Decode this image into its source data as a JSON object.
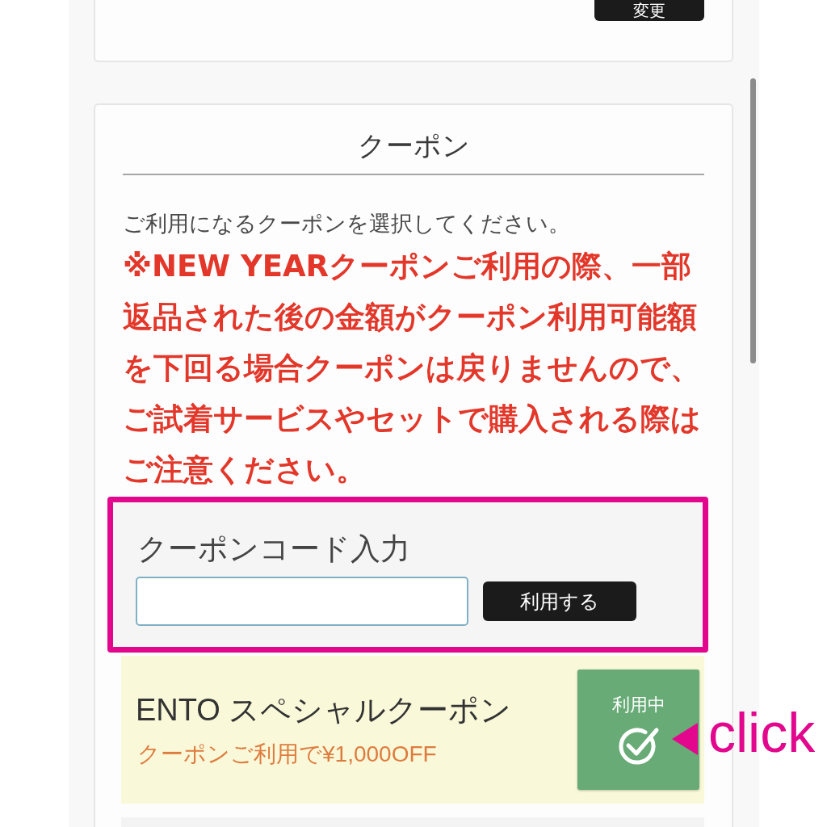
{
  "top_card": {
    "button": "変更"
  },
  "coupon_section": {
    "title": "クーポン",
    "instruction": "ご利用になるクーポンを選択してください。",
    "warning": "※NEW YEARクーポンご利用の際、一部返品された後の金額がクーポン利用可能額を下回る場合クーポンは戻りませんので、ご試着サービスやセットで購入される際はご注意ください。",
    "code_entry": {
      "label": "クーポンコード入力",
      "button": "利用する",
      "highlighted": true
    },
    "coupons": [
      {
        "name": "ENTO スペシャルクーポン",
        "note": "クーポンご利用で¥1,000OFF",
        "status": "利用中",
        "selected": true,
        "callout": "click"
      }
    ]
  }
}
